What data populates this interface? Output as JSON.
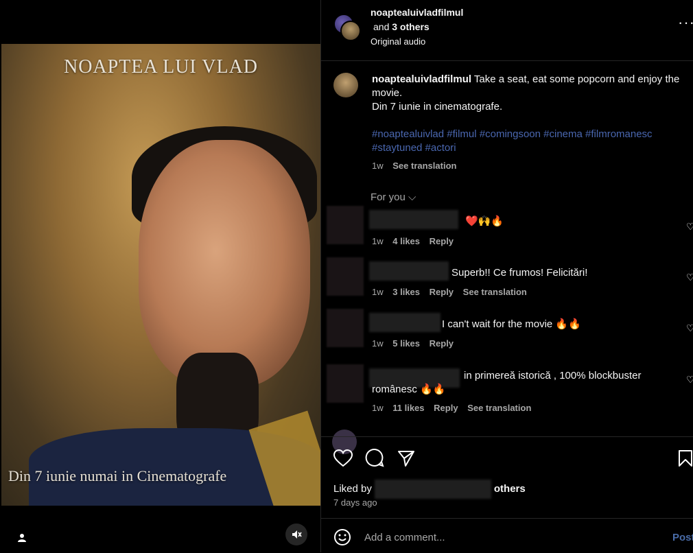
{
  "poster": {
    "title": "NOAPTEA LUI VLAD",
    "subtitle": "Din 7 iunie numai in Cinematografe"
  },
  "header": {
    "username": "noaptealuivladfilmul",
    "others_prefix": "and ",
    "others": "3 others",
    "audio": "Original audio",
    "more_icon": "more-icon"
  },
  "caption": {
    "username": "noaptealuivladfilmul",
    "line1": " Take a seat, eat some popcorn and enjoy the movie.",
    "line2": "Din 7 iunie in cinematografe.",
    "tags": "#noaptealuivlad #filmul #comingsoon #cinema #filmromanesc #staytuned #actori",
    "age": "1w",
    "translate": "See translation"
  },
  "for_you": "For you",
  "comments": [
    {
      "text": "❤️🙌🔥",
      "age": "1w",
      "likes": "4 likes",
      "reply": "Reply",
      "translate": ""
    },
    {
      "text": "Superb!! Ce frumos! Felicitări!",
      "age": "1w",
      "likes": "3 likes",
      "reply": "Reply",
      "translate": "See translation"
    },
    {
      "text": "I can't wait for the movie 🔥🔥",
      "age": "1w",
      "likes": "5 likes",
      "reply": "Reply",
      "translate": ""
    },
    {
      "text": "in primereă istorică , 100% blockbuster românesc 🔥🔥",
      "age": "1w",
      "likes": "11 likes",
      "reply": "Reply",
      "translate": "See translation"
    }
  ],
  "actions": {
    "liked_prefix": "Liked by",
    "liked_suffix": "others",
    "age": "7 days ago"
  },
  "add_comment": {
    "placeholder": "Add a comment...",
    "post": "Post"
  }
}
